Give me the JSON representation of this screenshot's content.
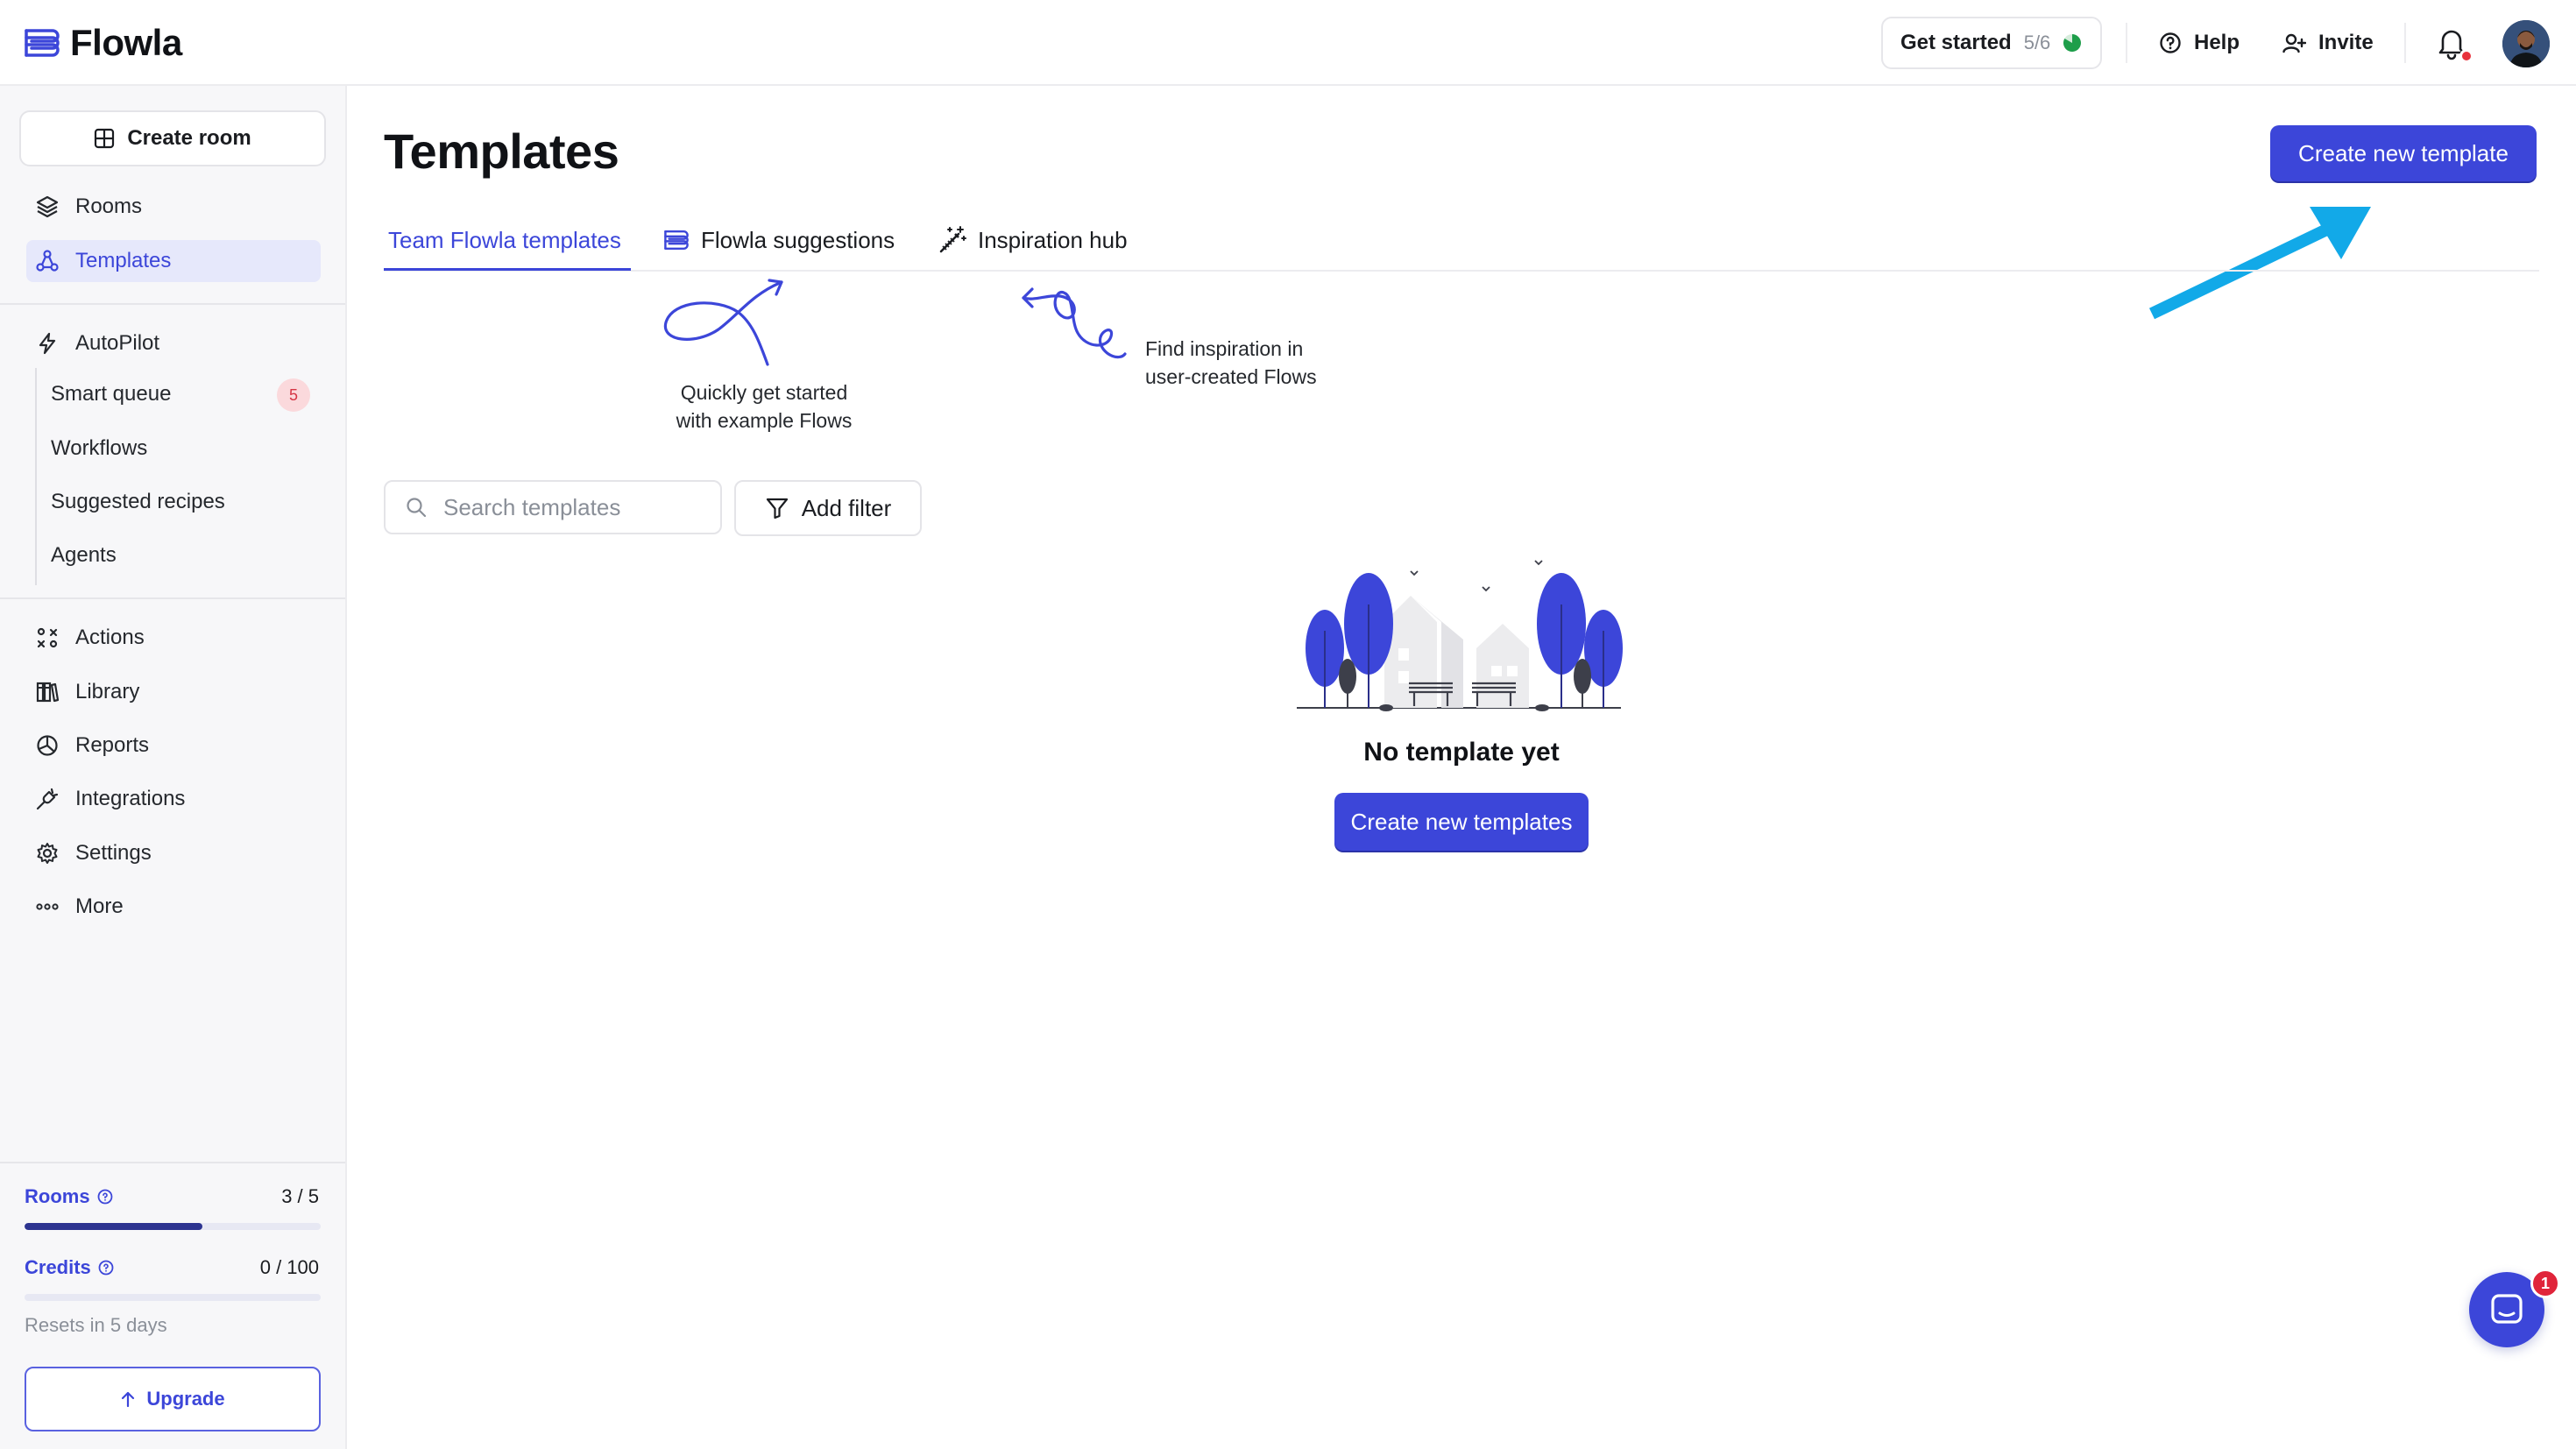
{
  "app": {
    "name": "Flowla"
  },
  "topbar": {
    "get_started_label": "Get started",
    "get_started_progress": "5/6",
    "get_started_fraction": 0.83,
    "help_label": "Help",
    "invite_label": "Invite"
  },
  "sidebar": {
    "create_room_label": "Create room",
    "primary_items": [
      {
        "label": "Rooms",
        "icon": "layers-icon"
      },
      {
        "label": "Templates",
        "icon": "templates-icon",
        "active": true
      }
    ],
    "autopilot": {
      "label": "AutoPilot",
      "icon": "lightning-icon",
      "children": [
        {
          "label": "Smart queue",
          "badge": "5"
        },
        {
          "label": "Workflows"
        },
        {
          "label": "Suggested recipes"
        },
        {
          "label": "Agents"
        }
      ]
    },
    "secondary_items": [
      {
        "label": "Actions",
        "icon": "actions-icon"
      },
      {
        "label": "Library",
        "icon": "library-icon"
      },
      {
        "label": "Reports",
        "icon": "pie-chart-icon"
      },
      {
        "label": "Integrations",
        "icon": "plug-icon"
      },
      {
        "label": "Settings",
        "icon": "gear-icon"
      },
      {
        "label": "More",
        "icon": "more-icon"
      }
    ],
    "quota": {
      "rooms_label": "Rooms",
      "rooms_value": "3 / 5",
      "rooms_fraction": 0.6,
      "credits_label": "Credits",
      "credits_value": "0 / 100",
      "credits_fraction": 0.0,
      "resets_text": "Resets in 5 days"
    },
    "upgrade_label": "Upgrade"
  },
  "main": {
    "title": "Templates",
    "create_button_label": "Create new template",
    "tabs": [
      {
        "label": "Team Flowla templates",
        "active": true
      },
      {
        "label": "Flowla suggestions",
        "icon": "flowla-logo-icon"
      },
      {
        "label": "Inspiration hub",
        "icon": "magic-wand-icon"
      }
    ],
    "hints": {
      "suggestions_line1": "Quickly get started",
      "suggestions_line2": "with example Flows",
      "inspiration_line1": "Find inspiration in",
      "inspiration_line2": "user-created Flows"
    },
    "search_placeholder": "Search templates",
    "filter_label": "Add filter",
    "empty_state": {
      "title": "No template yet",
      "button_label": "Create new templates"
    }
  },
  "chat": {
    "badge": "1"
  },
  "colors": {
    "accent": "#3C46D9",
    "accent_light": "#E6E8FB",
    "annotation_arrow": "#12A9E8",
    "progress_green": "#1E9E4A",
    "alert_red": "#E0243A"
  }
}
